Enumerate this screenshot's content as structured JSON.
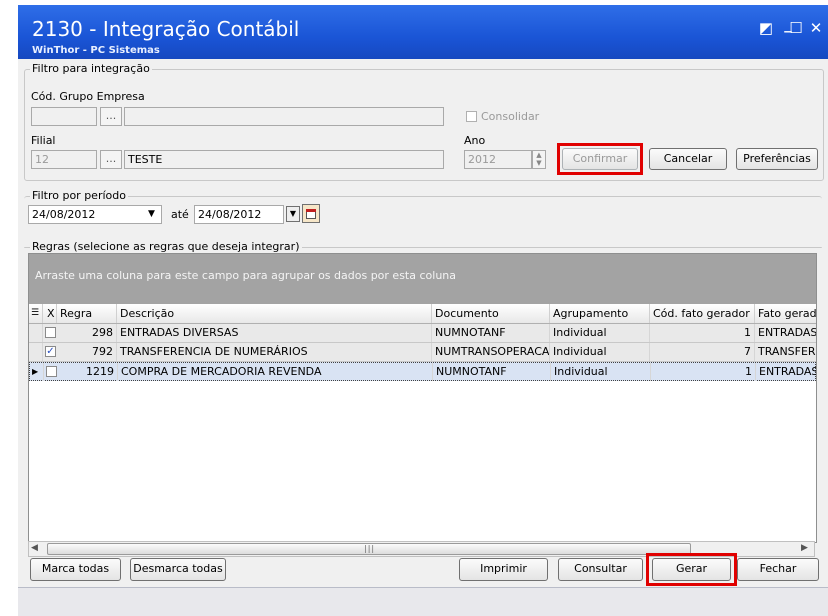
{
  "window": {
    "title": "2130 - Integração Contábil",
    "subtitle": "WinThor - PC Sistemas",
    "restore_glyph": "◩",
    "minimize_glyph": "_",
    "maximize_glyph": "☐",
    "close_glyph": "✕"
  },
  "filtro_integracao": {
    "title": "Filtro para integração",
    "cod_grupo_label": "Cód. Grupo Empresa",
    "cod_grupo_value": "",
    "grupo_desc_value": "",
    "consolidar_label": "Consolidar",
    "consolidar_checked": false,
    "filial_label": "Filial",
    "filial_value": "12",
    "filial_desc": "TESTE",
    "ano_label": "Ano",
    "ano_value": "2012",
    "ellipsis": "...",
    "confirmar_label": "Confirmar",
    "cancelar_label": "Cancelar",
    "preferencias_label": "Preferências"
  },
  "filtro_periodo": {
    "title": "Filtro por período",
    "data_inicio": "24/08/2012",
    "ate_label": "até",
    "data_fim": "24/08/2012"
  },
  "regras": {
    "title": "Regras (selecione as regras que deseja integrar)",
    "group_hint": "Arraste uma coluna para este campo para agrupar os dados por esta coluna",
    "columns": {
      "x": "X",
      "regra": "Regra",
      "descricao": "Descrição",
      "documento": "Documento",
      "agrupamento": "Agrupamento",
      "cod_fato": "Cód. fato gerador",
      "fato": "Fato gerado"
    },
    "rows": [
      {
        "checked": false,
        "regra": "298",
        "descricao": "ENTRADAS DIVERSAS",
        "documento": "NUMNOTANF",
        "agrupamento": "Individual",
        "cod_fato": "1",
        "fato": "ENTRADAS"
      },
      {
        "checked": true,
        "regra": "792",
        "descricao": "TRANSFERENCIA DE NUMERÁRIOS",
        "documento": "NUMTRANSOPERACA",
        "agrupamento": "Individual",
        "cod_fato": "7",
        "fato": "TRANSFERÊI"
      },
      {
        "checked": false,
        "regra": "1219",
        "descricao": "COMPRA DE MERCADORIA REVENDA",
        "documento": "NUMNOTANF",
        "agrupamento": "Individual",
        "cod_fato": "1",
        "fato": "ENTRADAS"
      }
    ],
    "check_glyph": "✓",
    "current_row_glyph": "▶"
  },
  "buttons": {
    "marca_todas": "Marca todas",
    "desmarca_todas": "Desmarca todas",
    "imprimir": "Imprimir",
    "consultar": "Consultar",
    "gerar": "Gerar",
    "fechar": "Fechar"
  },
  "colors": {
    "titlebar": "#1a55d6",
    "highlight": "#e00000",
    "group_area": "#a3a3a3"
  }
}
